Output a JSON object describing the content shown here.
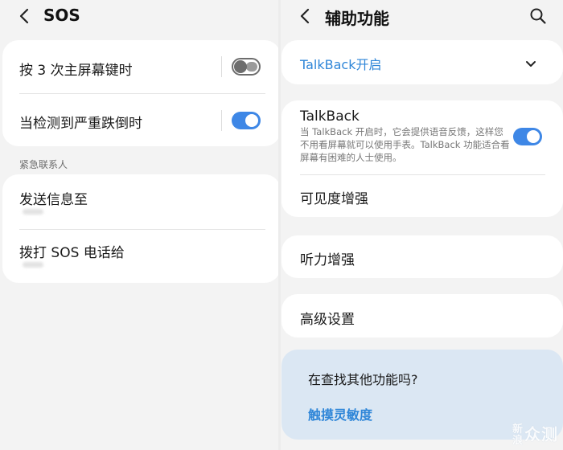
{
  "left": {
    "title": "SOS",
    "rows": [
      {
        "label": "按 3 次主屏幕键时",
        "toggle": "off"
      },
      {
        "label": "当检测到严重跌倒时",
        "toggle": "on"
      }
    ],
    "section": "紧急联系人",
    "contacts": [
      {
        "label": "发送信息至"
      },
      {
        "label": "拨打 SOS 电话给"
      }
    ]
  },
  "right": {
    "title": "辅助功能",
    "talkback_dropdown": "TalkBack开启",
    "talkback": {
      "title": "TalkBack",
      "description": "当 TalkBack 开启时，它会提供语音反馈，这样您不用看屏幕就可以使用手表。TalkBack 功能适合看屏幕有困难的人士使用。",
      "toggle": "on"
    },
    "items": [
      "可见度增强",
      "听力增强",
      "高级设置"
    ],
    "help": {
      "question": "在查找其他功能吗?",
      "link": "触摸灵敏度"
    },
    "watermark": {
      "small": "新浪",
      "big": "众测"
    }
  },
  "colors": {
    "accent": "#3e87e6",
    "link": "#2f86d8",
    "background": "#f3f3f3",
    "card": "#ffffff",
    "help_card": "#dbe7f3"
  },
  "icons": [
    "back-arrow-icon",
    "search-icon",
    "chevron-down-icon"
  ]
}
